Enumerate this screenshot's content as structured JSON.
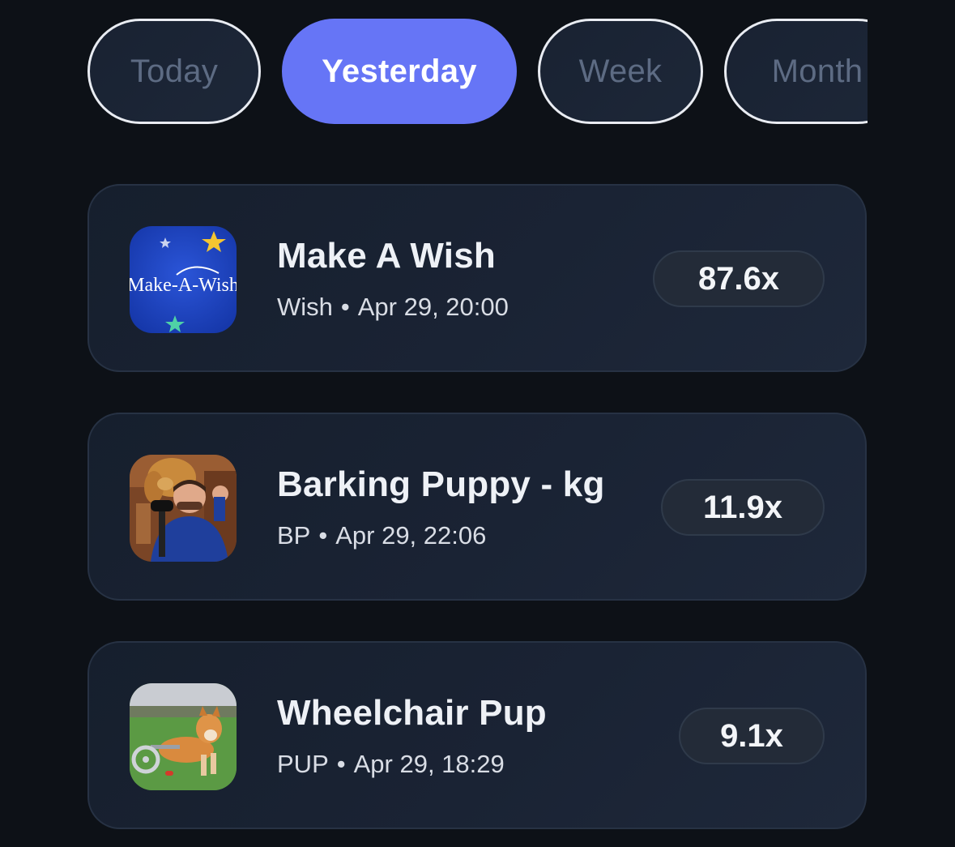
{
  "tabs": [
    {
      "label": "Today",
      "active": false
    },
    {
      "label": "Yesterday",
      "active": true
    },
    {
      "label": "Week",
      "active": false
    },
    {
      "label": "Month",
      "active": false
    }
  ],
  "items": [
    {
      "title": "Make A Wish",
      "ticker": "Wish",
      "separator": "•",
      "datetime": "Apr 29, 20:00",
      "multiplier": "87.6x",
      "image_text": "Make-A-Wish",
      "image_icon": "make-a-wish-logo-icon"
    },
    {
      "title": "Barking Puppy - kg",
      "ticker": "BP",
      "separator": "•",
      "datetime": "Apr 29, 22:06",
      "multiplier": "11.9x",
      "image_icon": "man-with-dog-photo-icon"
    },
    {
      "title": "Wheelchair Pup",
      "ticker": "PUP",
      "separator": "•",
      "datetime": "Apr 29, 18:29",
      "multiplier": "9.1x",
      "image_icon": "dog-wheelchair-photo-icon"
    }
  ],
  "colors": {
    "background": "#0d1117",
    "accent": "#6675f6",
    "card": "#1a2334",
    "inactive_tab_text": "#5d6b83"
  }
}
